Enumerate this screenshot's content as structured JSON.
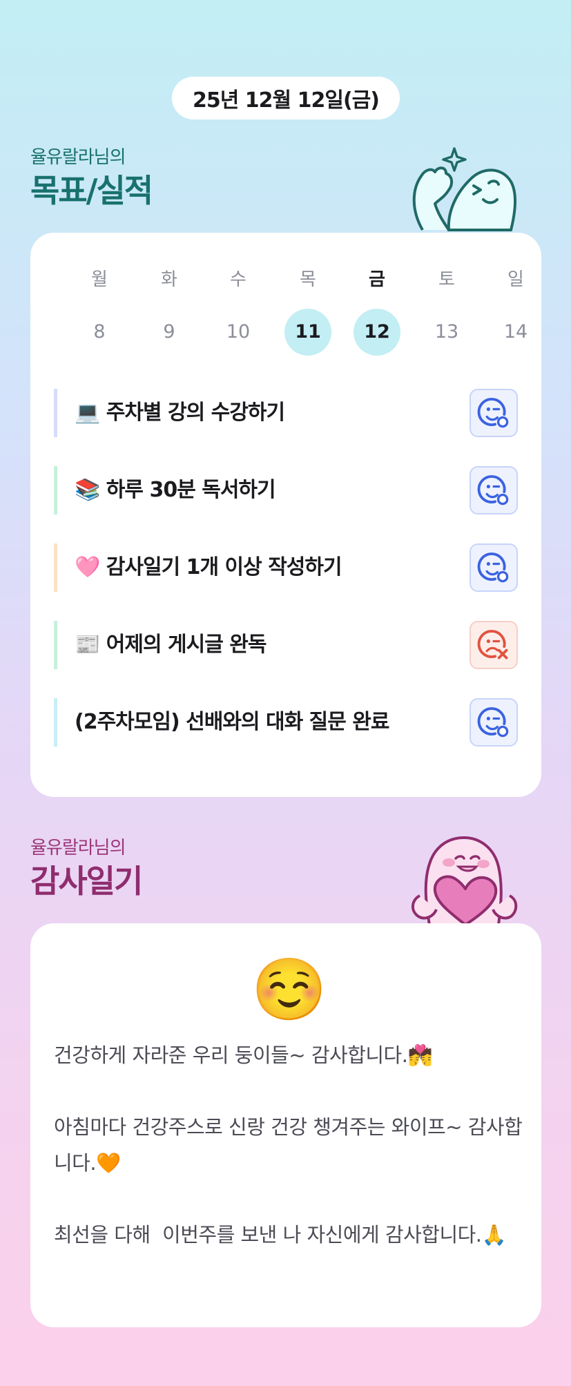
{
  "header": {
    "date": "25년 12월 12일(금)"
  },
  "goals_section": {
    "subtitle": "율유랄라님의",
    "title": "목표/실적",
    "week": {
      "days": [
        {
          "name": "월",
          "num": "8"
        },
        {
          "name": "화",
          "num": "9"
        },
        {
          "name": "수",
          "num": "10"
        },
        {
          "name": "목",
          "num": "11"
        },
        {
          "name": "금",
          "num": "12"
        },
        {
          "name": "토",
          "num": "13"
        },
        {
          "name": "일",
          "num": "14"
        }
      ],
      "today_name": "금",
      "highlighted": [
        "11",
        "12"
      ]
    },
    "goals": [
      {
        "label": "💻 주차별 강의 수강하기",
        "status": "achieved",
        "color": "#d7dcfa"
      },
      {
        "label": "📚 하루 30분 독서하기",
        "status": "achieved",
        "color": "#c6f0dc"
      },
      {
        "label": "🩷 감사일기 1개 이상 작성하기",
        "status": "achieved",
        "color": "#fde1c4"
      },
      {
        "label": "📰 어제의 게시글 완독",
        "status": "failed",
        "color": "#c6f0dc"
      },
      {
        "label": "(2주차모임) 선배와의 대화 질문 완료",
        "status": "achieved",
        "color": "#c8eef6"
      }
    ]
  },
  "thanks_section": {
    "subtitle": "율유랄라님의",
    "title": "감사일기",
    "emoji": "☺️",
    "text": "건강하게 자라준 우리 둥이들~ 감사합니다.💏\n\n아침마다 건강주스로 신랑 건강 챙겨주는 와이프~ 감사합니다.🧡\n\n최선을 다해  이번주를 보낸 나 자신에게 감사합니다.🙏"
  },
  "colors": {
    "goal_title": "#18716f",
    "thanks_title": "#8f2d6e",
    "achieved_icon": "#3b63e0",
    "failed_icon": "#e0533f",
    "day_highlight": "#c2eef4"
  },
  "icons": {
    "achieved": "smile-face-icon",
    "failed": "sad-face-icon",
    "goal_mascot": "sparkle-mascot-icon",
    "thanks_mascot": "heart-mascot-icon"
  }
}
